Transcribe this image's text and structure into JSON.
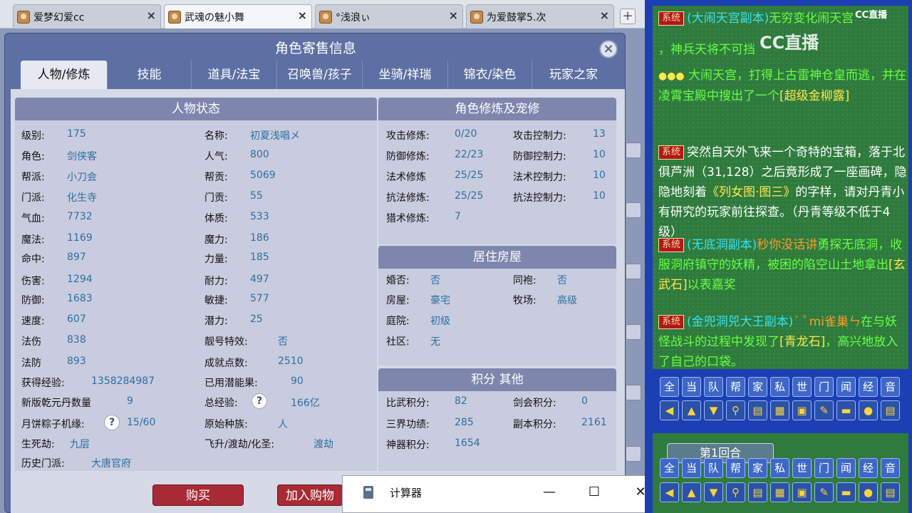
{
  "browser": {
    "tabs": [
      {
        "label": "爱梦幻爱cc"
      },
      {
        "label": "武魂の魅小舞"
      },
      {
        "label": "°浅浪ぃ"
      },
      {
        "label": "为爱鼓掌5.次"
      }
    ],
    "close_symbol": "×",
    "new_tab_symbol": "+"
  },
  "dialog": {
    "title": "角色寄售信息",
    "close_symbol": "×",
    "tabs": [
      "人物/修炼",
      "技能",
      "道具/法宝",
      "召唤兽/孩子",
      "坐骑/祥瑞",
      "锦衣/染色",
      "玩家之家"
    ],
    "active_tab": "人物/修炼"
  },
  "status": {
    "title": "人物状态",
    "left": [
      {
        "label": "级别:",
        "value": "175"
      },
      {
        "label": "角色:",
        "value": "剑侠客"
      },
      {
        "label": "帮派:",
        "value": "小刀会"
      },
      {
        "label": "门派:",
        "value": "化生寺"
      },
      {
        "label": "气血:",
        "value": "7732"
      },
      {
        "label": "魔法:",
        "value": "1169"
      },
      {
        "label": "命中:",
        "value": "897"
      },
      {
        "label": "伤害:",
        "value": "1294"
      },
      {
        "label": "防御:",
        "value": "1683"
      },
      {
        "label": "速度:",
        "value": "607"
      },
      {
        "label": "法伤",
        "value": "838"
      },
      {
        "label": "法防",
        "value": "893"
      }
    ],
    "right": [
      {
        "label": "名称:",
        "value": "初夏浅唱メ"
      },
      {
        "label": "人气:",
        "value": "800"
      },
      {
        "label": "帮贡:",
        "value": "5069"
      },
      {
        "label": "门贡:",
        "value": "55"
      },
      {
        "label": "体质:",
        "value": "533"
      },
      {
        "label": "魔力:",
        "value": "186"
      },
      {
        "label": "力量:",
        "value": "185"
      },
      {
        "label": "耐力:",
        "value": "497"
      },
      {
        "label": "敏捷:",
        "value": "577"
      },
      {
        "label": "潜力:",
        "value": "25"
      },
      {
        "label": "靓号特效:",
        "value": "否"
      },
      {
        "label": "成就点数:",
        "value": "2510"
      }
    ],
    "extra": [
      {
        "label": "获得经验:",
        "value": "1358284987"
      },
      {
        "label": "已用潜能果:",
        "value": "90"
      },
      {
        "label": "新版乾元丹数量",
        "value": "9"
      },
      {
        "label": "总经验:",
        "value": "166亿"
      },
      {
        "label": "月饼粽子机缘:",
        "value": "15/60"
      },
      {
        "label": "原始种族:",
        "value": "人"
      },
      {
        "label": "生死劫:",
        "value": "九层"
      },
      {
        "label": "飞升/渡劫/化圣:",
        "value": "渡劫"
      },
      {
        "label": "历史门派:",
        "value": "大唐官府"
      }
    ],
    "hint_symbol": "?"
  },
  "cultivation": {
    "title": "角色修炼及宠修",
    "rows": [
      {
        "label": "攻击修炼:",
        "value": "0/20",
        "label2": "攻击控制力:",
        "value2": "13"
      },
      {
        "label": "防御修炼:",
        "value": "22/23",
        "label2": "防御控制力:",
        "value2": "10"
      },
      {
        "label": "法术修炼",
        "value": "25/25",
        "label2": "法术控制力:",
        "value2": "10"
      },
      {
        "label": "抗法修炼:",
        "value": "25/25",
        "label2": "抗法控制力:",
        "value2": "10"
      },
      {
        "label": "猎术修炼:",
        "value": "7"
      }
    ]
  },
  "house": {
    "title": "居住房屋",
    "rows": [
      {
        "label": "婚否:",
        "value": "否",
        "label2": "同袍:",
        "value2": "否"
      },
      {
        "label": "房屋:",
        "value": "豪宅",
        "label2": "牧场:",
        "value2": "高级"
      },
      {
        "label": "庭院:",
        "value": "初级"
      },
      {
        "label": "社区:",
        "value": "无"
      }
    ]
  },
  "points": {
    "title": "积分 其他",
    "rows": [
      {
        "label": "比武积分:",
        "value": "82",
        "label2": "剑会积分:",
        "value2": "0"
      },
      {
        "label": "三界功绩:",
        "value": "285",
        "label2": "副本积分:",
        "value2": "2161"
      },
      {
        "label": "神器积分:",
        "value": "1654"
      }
    ]
  },
  "buttons": {
    "buy": "购买",
    "add_cart": "加入购物"
  },
  "calculator": {
    "title": "计算器",
    "minimize": "—",
    "maximize": "☐",
    "close": "✕"
  },
  "chat": {
    "system_tag": "系统",
    "logo": "CC直播",
    "watermark": "CC直播",
    "msg1_a": "(大闹天宫副本)",
    "msg1_b": "无穷变化闹天宫",
    "msg1_c": "，神兵天将不可挡",
    "msg2_a": "大闹天宫，打得上古雷神仓皇而逃，并在凌霄宝殿中搜出了一个",
    "msg2_b": "[超级金柳露]",
    "msg3": "突然自天外飞来一个奇特的宝箱，落于北俱芦洲（31,128）之后竟形成了一座画碑，隐隐地刻着",
    "msg3_b": "《列女图·图三》",
    "msg3_c": "的字样，请对丹青小有研究的玩家前往探查。（丹青等级不低于4级）",
    "msg4_a": "(无底洞副本)",
    "msg4_b": "秒你没话讲",
    "msg4_c": "勇探无底洞，收服洞府镇守的妖精，被困的陷空山土地拿出",
    "msg4_d": "[玄武石]",
    "msg4_e": "以表嘉奖",
    "msg5_a": "(金兜洞兕大王副本)",
    "msg5_b": "ˊ ﾟmi雀巢ㄣ",
    "msg5_c": "在与妖怪战斗的过程中发现了",
    "msg5_d": "[青龙石]",
    "msg5_e": "，高兴地放入了自己的口袋。",
    "commands": [
      "全",
      "当",
      "队",
      "帮",
      "家",
      "私",
      "世",
      "门",
      "闻",
      "经",
      "音"
    ],
    "round_label": "第1回合"
  }
}
